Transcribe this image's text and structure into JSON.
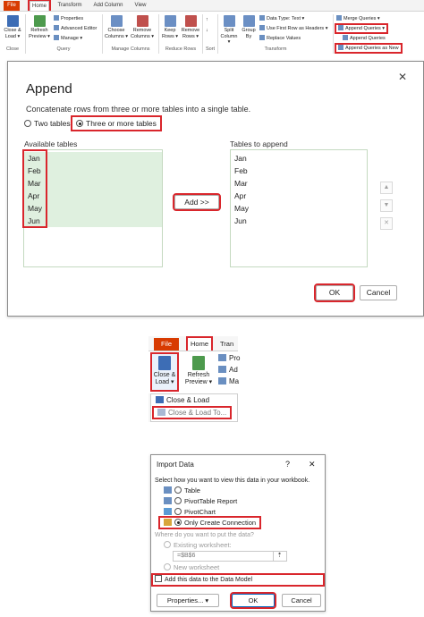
{
  "ribbon1": {
    "tabs": [
      "File",
      "Home",
      "Transform",
      "Add Column",
      "View"
    ],
    "buttons": {
      "close_load": "Close & Load ▾",
      "refresh_preview": "Refresh Preview ▾",
      "properties": "Properties",
      "advanced_editor": "Advanced Editor",
      "manage": "Manage ▾",
      "choose_columns": "Choose Columns ▾",
      "remove_columns": "Remove Columns ▾",
      "keep_rows": "Keep Rows ▾",
      "remove_rows": "Remove Rows ▾",
      "split_column": "Split Column ▾",
      "group_by": "Group By",
      "data_type": "Data Type: Text ▾",
      "use_first_row": "Use First Row as Headers ▾",
      "replace_values": "Replace Values",
      "merge_queries": "Merge Queries ▾",
      "append_queries": "Append Queries ▾",
      "append_queries_as_new": "Append Queries as New"
    },
    "groups": {
      "close": "Close",
      "query": "Query",
      "manage_columns": "Manage Columns",
      "reduce_rows": "Reduce Rows",
      "sort": "Sort",
      "transform": "Transform"
    }
  },
  "append_dialog": {
    "title": "Append",
    "description": "Concatenate rows from three or more tables into a single table.",
    "option_two": "Two tables",
    "option_three": "Three or more tables",
    "available_label": "Available tables",
    "append_label": "Tables to append",
    "available_tables": [
      "Jan",
      "Feb",
      "Mar",
      "Apr",
      "May",
      "Jun"
    ],
    "tables_to_append": [
      "Jan",
      "Feb",
      "Mar",
      "Apr",
      "May",
      "Jun"
    ],
    "add_button": "Add >>",
    "ok_button": "OK",
    "cancel_button": "Cancel",
    "close_glyph": "✕"
  },
  "ribbon2": {
    "file_tab": "File",
    "home_tab": "Home",
    "transform_tab": "Tran",
    "close_load_button": "Close & Load ▾",
    "refresh_preview_button": "Refresh Preview ▾",
    "props_partial": [
      "Pro",
      "Ad",
      "Ma"
    ],
    "menu_close_load": "Close & Load",
    "menu_close_load_to": "Close & Load To..."
  },
  "import_dialog": {
    "title": "Import Data",
    "help_glyph": "?",
    "close_glyph": "✕",
    "prompt": "Select how you want to view this data in your workbook.",
    "options": [
      "Table",
      "PivotTable Report",
      "PivotChart",
      "Only Create Connection"
    ],
    "where_label": "Where do you want to put the data?",
    "existing_worksheet": "Existing worksheet:",
    "cell_ref": "=$B$6",
    "new_worksheet": "New worksheet",
    "data_model_label": "Add this data to the Data Model",
    "properties_button": "Properties... ▾",
    "ok_button": "OK",
    "cancel_button": "Cancel"
  }
}
